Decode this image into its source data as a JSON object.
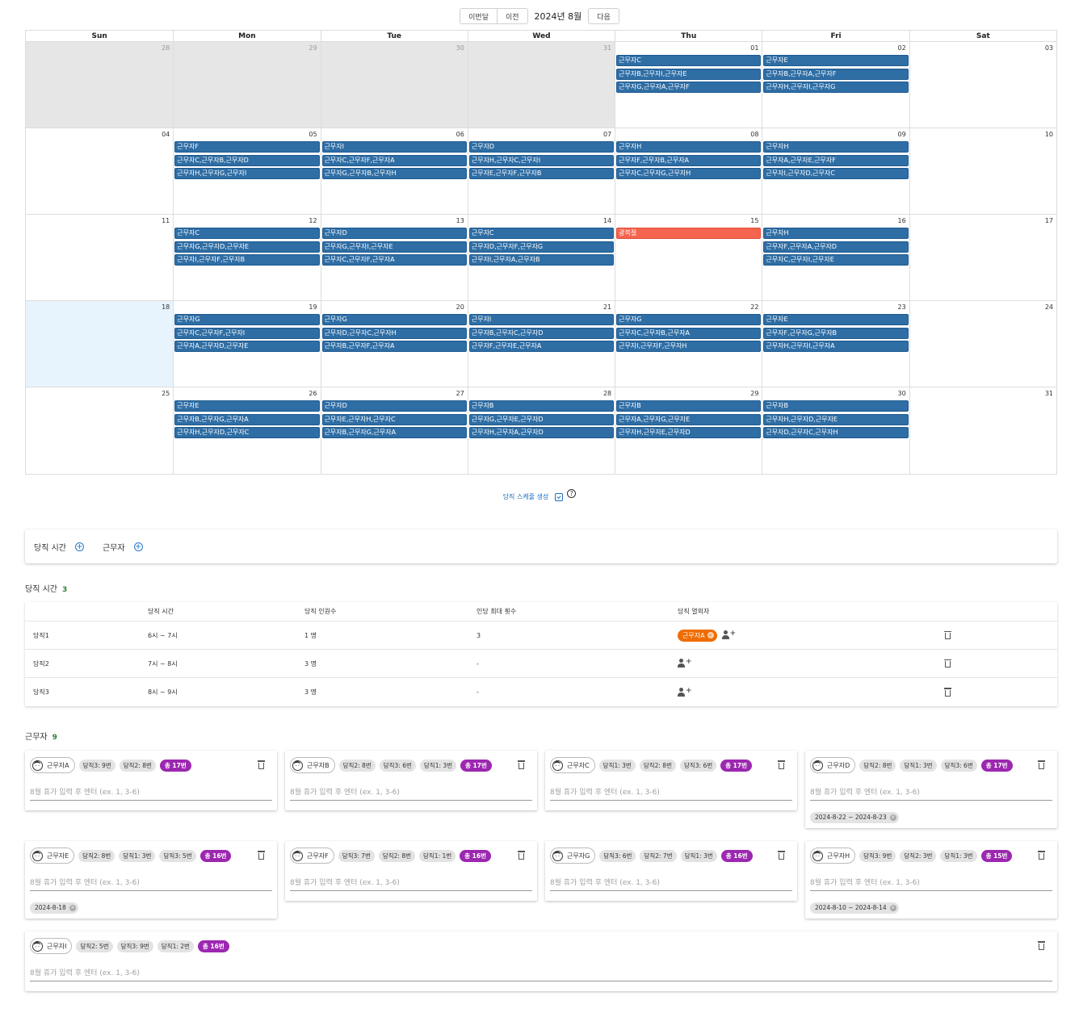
{
  "toolbar": {
    "this_month": "이번달",
    "prev": "이전",
    "title": "2024년 8월",
    "next": "다음"
  },
  "calendar": {
    "weekdays": [
      "Sun",
      "Mon",
      "Tue",
      "Wed",
      "Thu",
      "Fri",
      "Sat"
    ],
    "weeks": [
      [
        {
          "day": "28",
          "other": true,
          "today": false,
          "events": []
        },
        {
          "day": "29",
          "other": true,
          "today": false,
          "events": []
        },
        {
          "day": "30",
          "other": true,
          "today": false,
          "events": []
        },
        {
          "day": "31",
          "other": true,
          "today": false,
          "events": []
        },
        {
          "day": "01",
          "other": false,
          "today": false,
          "events": [
            "근무자C",
            "근무자B,근무자I,근무자E",
            "근무자G,근무자A,근무자F"
          ]
        },
        {
          "day": "02",
          "other": false,
          "today": false,
          "events": [
            "근무자E",
            "근무자B,근무자A,근무자F",
            "근무자H,근무자I,근무자G"
          ]
        },
        {
          "day": "03",
          "other": false,
          "today": false,
          "events": []
        }
      ],
      [
        {
          "day": "04",
          "other": false,
          "today": false,
          "events": []
        },
        {
          "day": "05",
          "other": false,
          "today": false,
          "events": [
            "근무자F",
            "근무자C,근무자B,근무자D",
            "근무자H,근무자G,근무자I"
          ]
        },
        {
          "day": "06",
          "other": false,
          "today": false,
          "events": [
            "근무자I",
            "근무자C,근무자F,근무자A",
            "근무자G,근무자B,근무자H"
          ]
        },
        {
          "day": "07",
          "other": false,
          "today": false,
          "events": [
            "근무자D",
            "근무자H,근무자C,근무자I",
            "근무자E,근무자F,근무자B"
          ]
        },
        {
          "day": "08",
          "other": false,
          "today": false,
          "events": [
            "근무자H",
            "근무자F,근무자B,근무자A",
            "근무자C,근무자G,근무자H"
          ]
        },
        {
          "day": "09",
          "other": false,
          "today": false,
          "events": [
            "근무자H",
            "근무자A,근무자E,근무자F",
            "근무자I,근무자D,근무자C"
          ]
        },
        {
          "day": "10",
          "other": false,
          "today": false,
          "events": []
        }
      ],
      [
        {
          "day": "11",
          "other": false,
          "today": false,
          "events": []
        },
        {
          "day": "12",
          "other": false,
          "today": false,
          "events": [
            "근무자C",
            "근무자G,근무자D,근무자E",
            "근무자I,근무자F,근무자B"
          ]
        },
        {
          "day": "13",
          "other": false,
          "today": false,
          "events": [
            "근무자D",
            "근무자G,근무자I,근무자E",
            "근무자C,근무자F,근무자A"
          ]
        },
        {
          "day": "14",
          "other": false,
          "today": false,
          "events": [
            "근무자C",
            "근무자D,근무자F,근무자G",
            "근무자I,근무자A,근무자B"
          ]
        },
        {
          "day": "15",
          "other": false,
          "today": false,
          "holiday": "광복절",
          "events": []
        },
        {
          "day": "16",
          "other": false,
          "today": false,
          "events": [
            "근무자H",
            "근무자F,근무자A,근무자D",
            "근무자C,근무자I,근무자E"
          ]
        },
        {
          "day": "17",
          "other": false,
          "today": false,
          "events": []
        }
      ],
      [
        {
          "day": "18",
          "other": false,
          "today": true,
          "events": []
        },
        {
          "day": "19",
          "other": false,
          "today": false,
          "events": [
            "근무자G",
            "근무자C,근무자F,근무자I",
            "근무자A,근무자D,근무자E"
          ]
        },
        {
          "day": "20",
          "other": false,
          "today": false,
          "events": [
            "근무자G",
            "근무자D,근무자C,근무자H",
            "근무자B,근무자F,근무자A"
          ]
        },
        {
          "day": "21",
          "other": false,
          "today": false,
          "events": [
            "근무자I",
            "근무자B,근무자C,근무자D",
            "근무자F,근무자E,근무자A"
          ]
        },
        {
          "day": "22",
          "other": false,
          "today": false,
          "events": [
            "근무자G",
            "근무자C,근무자B,근무자A",
            "근무자I,근무자F,근무자H"
          ]
        },
        {
          "day": "23",
          "other": false,
          "today": false,
          "events": [
            "근무자E",
            "근무자F,근무자G,근무자B",
            "근무자H,근무자I,근무자A"
          ]
        },
        {
          "day": "24",
          "other": false,
          "today": false,
          "events": []
        }
      ],
      [
        {
          "day": "25",
          "other": false,
          "today": false,
          "events": []
        },
        {
          "day": "26",
          "other": false,
          "today": false,
          "events": [
            "근무자E",
            "근무자B,근무자G,근무자A",
            "근무자H,근무자D,근무자C"
          ]
        },
        {
          "day": "27",
          "other": false,
          "today": false,
          "events": [
            "근무자D",
            "근무자E,근무자H,근무자C",
            "근무자B,근무자G,근무자A"
          ]
        },
        {
          "day": "28",
          "other": false,
          "today": false,
          "events": [
            "근무자B",
            "근무자G,근무자E,근무자D",
            "근무자H,근무자A,근무자D"
          ]
        },
        {
          "day": "29",
          "other": false,
          "today": false,
          "events": [
            "근무자B",
            "근무자A,근무자G,근무자E",
            "근무자H,근무자E,근무자D"
          ]
        },
        {
          "day": "30",
          "other": false,
          "today": false,
          "events": [
            "근무자B",
            "근무자H,근무자D,근무자E",
            "근무자D,근무자C,근무자H"
          ]
        },
        {
          "day": "31",
          "other": false,
          "today": false,
          "events": []
        }
      ]
    ]
  },
  "generate": {
    "label": "당직 스케줄 생성",
    "help": "?"
  },
  "add_panel": {
    "duty_time": "당직 시간",
    "worker": "근무자"
  },
  "duty_section": {
    "title": "당직 시간",
    "count": "3"
  },
  "duty_table": {
    "headers": [
      "",
      "당직 시간",
      "당직 인원수",
      "인당 최대 횟수",
      "당직 열외자",
      ""
    ],
    "rows": [
      {
        "name": "당직1",
        "time": "6시 ~ 7시",
        "people": "1 명",
        "max": "3",
        "excluded": [
          "근무자A"
        ]
      },
      {
        "name": "당직2",
        "time": "7시 ~ 8시",
        "people": "3 명",
        "max": "-",
        "excluded": []
      },
      {
        "name": "당직3",
        "time": "8시 ~ 9시",
        "people": "3 명",
        "max": "-",
        "excluded": []
      }
    ]
  },
  "worker_section": {
    "title": "근무자",
    "count": "9"
  },
  "vacation_placeholder": "8월 휴가 입력 후 엔터 (ex. 1, 3-6)",
  "workers": [
    {
      "name": "근무자A",
      "stats": [
        "당직3: 9번",
        "당직2: 8번"
      ],
      "total": "총 17번",
      "vacations": []
    },
    {
      "name": "근무자B",
      "stats": [
        "당직2: 8번",
        "당직3: 6번",
        "당직1: 3번"
      ],
      "total": "총 17번",
      "vacations": []
    },
    {
      "name": "근무자C",
      "stats": [
        "당직1: 3번",
        "당직2: 8번",
        "당직3: 6번"
      ],
      "total": "총 17번",
      "vacations": []
    },
    {
      "name": "근무자D",
      "stats": [
        "당직2: 8번",
        "당직1: 3번",
        "당직3: 6번"
      ],
      "total": "총 17번",
      "vacations": [
        "2024-8-22 ~ 2024-8-23"
      ]
    },
    {
      "name": "근무자E",
      "stats": [
        "당직2: 8번",
        "당직1: 3번",
        "당직3: 5번"
      ],
      "total": "총 16번",
      "vacations": [
        "2024-8-18"
      ]
    },
    {
      "name": "근무자F",
      "stats": [
        "당직3: 7번",
        "당직2: 8번",
        "당직1: 1번"
      ],
      "total": "총 16번",
      "vacations": []
    },
    {
      "name": "근무자G",
      "stats": [
        "당직3: 6번",
        "당직2: 7번",
        "당직1: 3번"
      ],
      "total": "총 16번",
      "vacations": []
    },
    {
      "name": "근무자H",
      "stats": [
        "당직3: 9번",
        "당직2: 3번",
        "당직1: 3번"
      ],
      "total": "총 15번",
      "vacations": [
        "2024-8-10 ~ 2024-8-14"
      ]
    },
    {
      "name": "근무자I",
      "stats": [
        "당직2: 5번",
        "당직3: 9번",
        "당직1: 2번"
      ],
      "total": "총 16번",
      "vacations": []
    }
  ]
}
